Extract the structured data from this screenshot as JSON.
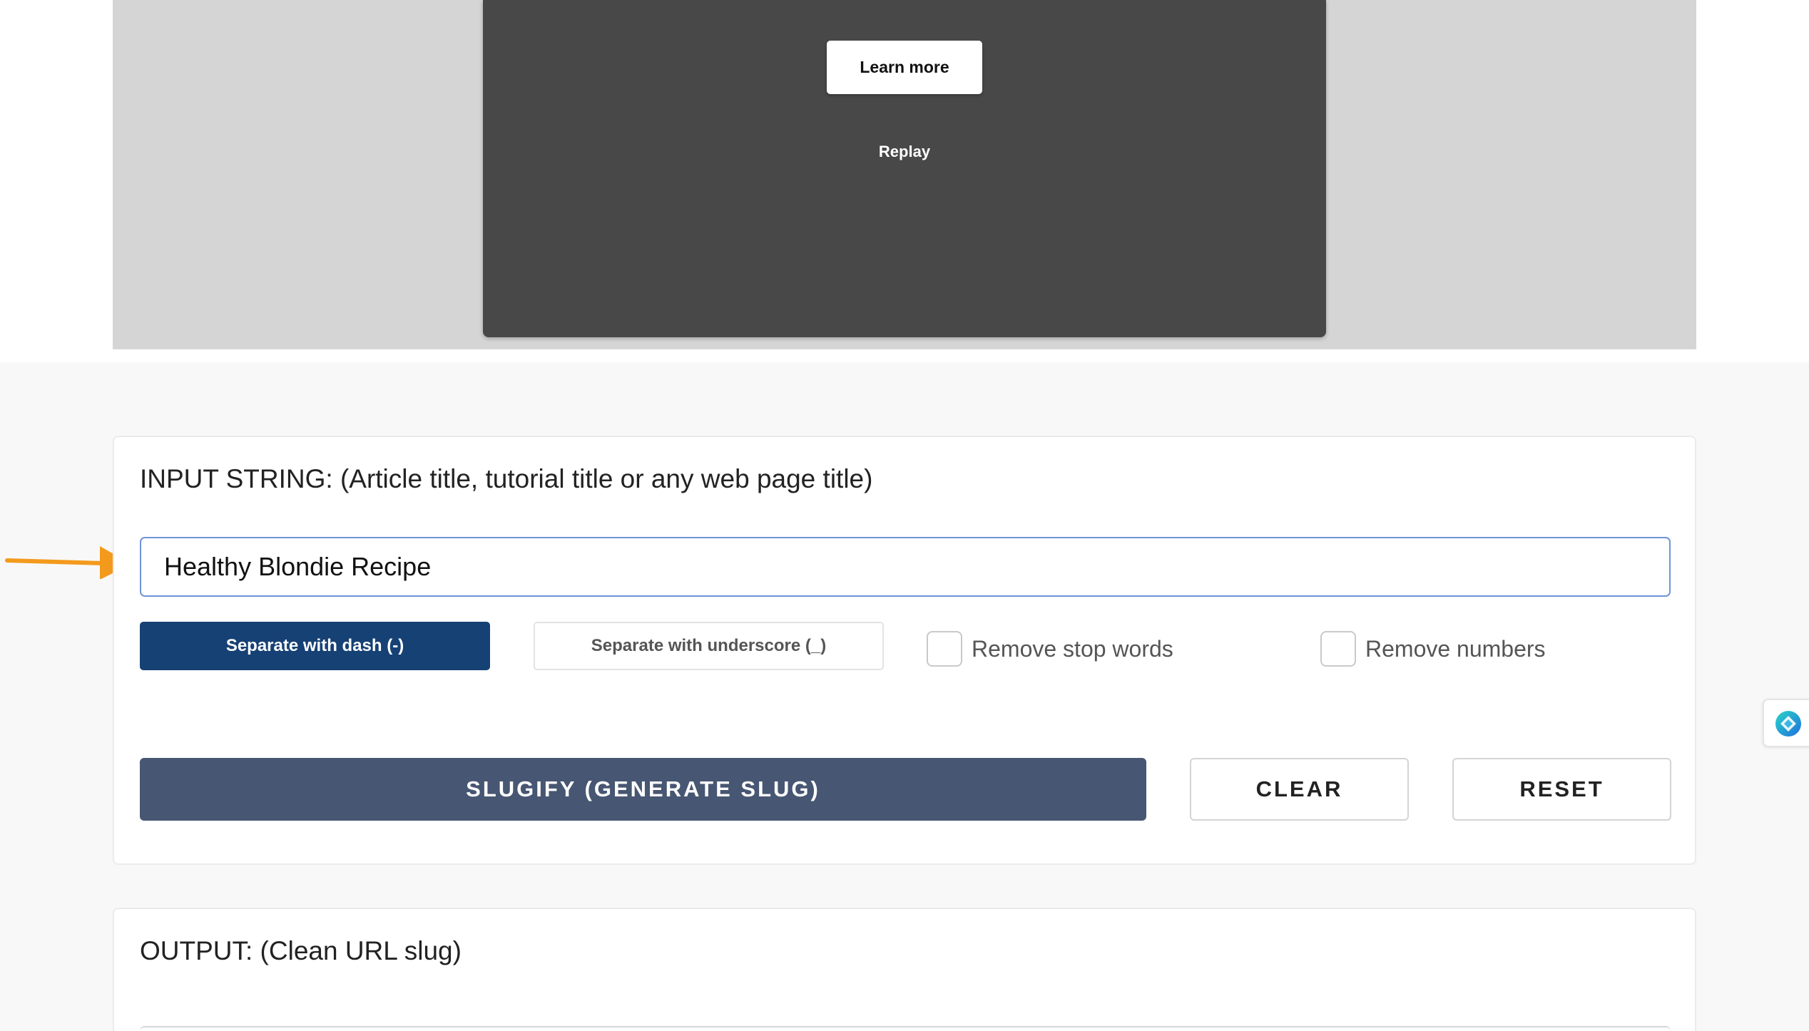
{
  "video_ad": {
    "learn_more_label": "Learn more",
    "replay_label": "Replay"
  },
  "input_card": {
    "label": "INPUT STRING: (Article title, tutorial title or any web page title)",
    "input_value": "Healthy Blondie Recipe",
    "separators": {
      "dash_label": "Separate with dash (-)",
      "underscore_label": "Separate with underscore (_)",
      "selected": "dash"
    },
    "options": {
      "remove_stop_words": {
        "label": "Remove stop words",
        "checked": false
      },
      "remove_numbers": {
        "label": "Remove numbers",
        "checked": false
      }
    },
    "actions": {
      "slugify_label": "SLUGIFY (GENERATE SLUG)",
      "clear_label": "CLEAR",
      "reset_label": "RESET"
    }
  },
  "output_card": {
    "label": "OUTPUT: (Clean URL slug)"
  },
  "colors": {
    "primary_dark_blue": "#164175",
    "slugify_button": "#475672",
    "input_border": "#6f94d8",
    "annotation_arrow": "#f39a1d"
  },
  "icons": {
    "side_widget": "assistant-logo-icon",
    "annotation": "arrow-right-icon"
  }
}
